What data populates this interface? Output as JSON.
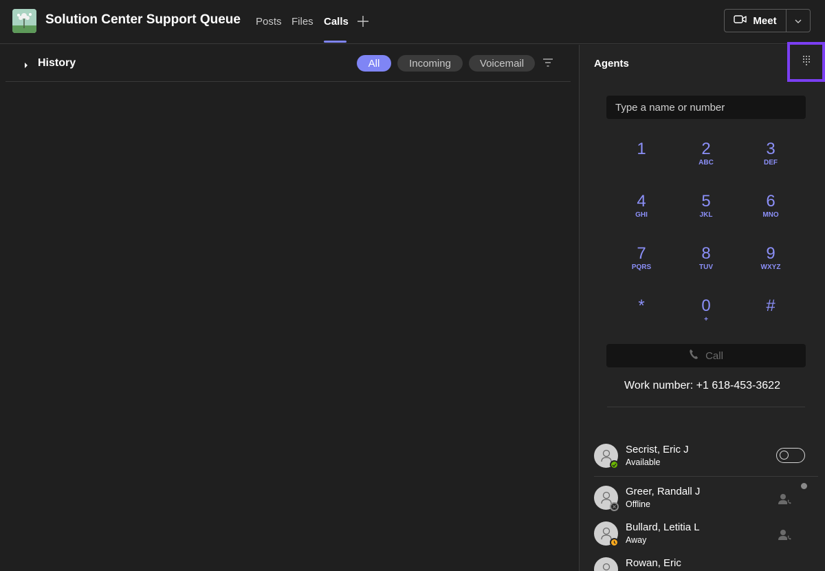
{
  "header": {
    "team_name": "Solution Center Support Queue",
    "tabs": [
      {
        "label": "Posts",
        "active": false
      },
      {
        "label": "Files",
        "active": false
      },
      {
        "label": "Calls",
        "active": true
      }
    ],
    "add_tab_icon": "plus-icon",
    "meet": {
      "label": "Meet",
      "icon": "video-camera-icon",
      "dropdown_icon": "chevron-down-icon"
    }
  },
  "history": {
    "title": "History",
    "filters": [
      {
        "label": "All",
        "active": true
      },
      {
        "label": "Incoming",
        "active": false
      },
      {
        "label": "Voicemail",
        "active": false
      }
    ],
    "filter_icon": "filter-icon"
  },
  "agents_panel": {
    "title": "Agents",
    "dialpad_toggle_icon": "dialpad-icon",
    "search_placeholder": "Type a name or number",
    "keypad": [
      {
        "digit": "1",
        "letters": ""
      },
      {
        "digit": "2",
        "letters": "ABC"
      },
      {
        "digit": "3",
        "letters": "DEF"
      },
      {
        "digit": "4",
        "letters": "GHI"
      },
      {
        "digit": "5",
        "letters": "JKL"
      },
      {
        "digit": "6",
        "letters": "MNO"
      },
      {
        "digit": "7",
        "letters": "PQRS"
      },
      {
        "digit": "8",
        "letters": "TUV"
      },
      {
        "digit": "9",
        "letters": "WXYZ"
      },
      {
        "digit": "*",
        "letters": ""
      },
      {
        "digit": "0",
        "letters": "+"
      },
      {
        "digit": "#",
        "letters": ""
      }
    ],
    "call_label": "Call",
    "work_number": "Work number: +1 618-453-3622",
    "agents": [
      {
        "name": "Secrist, Eric J",
        "status": "Available",
        "status_color": "#6bb700"
      },
      {
        "name": "Greer, Randall J",
        "status": "Offline",
        "status_color": "#8a8a8a"
      },
      {
        "name": "Bullard, Letitia L",
        "status": "Away",
        "status_color": "#fcaa1e"
      },
      {
        "name": "Rowan, Eric",
        "status": "",
        "status_color": "#8a8a8a"
      }
    ]
  },
  "colors": {
    "accent": "#7f85f5",
    "highlight_border": "#7b3ff2",
    "background": "#1f1f1f"
  }
}
